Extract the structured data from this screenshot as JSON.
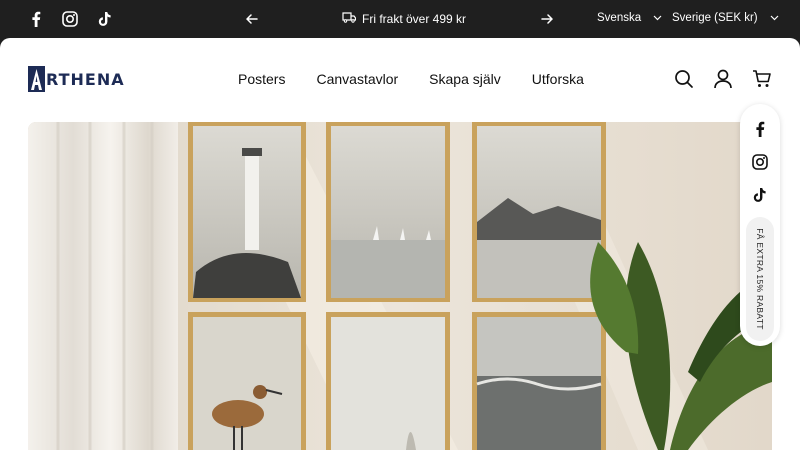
{
  "topbar": {
    "social_icons": [
      "facebook-icon",
      "instagram-icon",
      "tiktok-icon"
    ],
    "announcement": "Fri frakt över 499 kr",
    "announcement_icon": "truck-icon",
    "language": "Svenska",
    "country": "Sverige (SEK kr)"
  },
  "header": {
    "logo_text": "RTHENA",
    "nav": [
      "Posters",
      "Canvastavlor",
      "Skapa själv",
      "Utforska"
    ],
    "icons": [
      "search-icon",
      "account-icon",
      "cart-icon"
    ]
  },
  "floating_bar": {
    "icons": [
      "facebook-icon",
      "instagram-icon",
      "tiktok-icon"
    ],
    "promo": "FÅ EXTRA 15% RABATT"
  },
  "colors": {
    "topbar_bg": "#1f1f1f",
    "brand_navy": "#1d2b55",
    "frame_gold": "#c9a25c"
  }
}
